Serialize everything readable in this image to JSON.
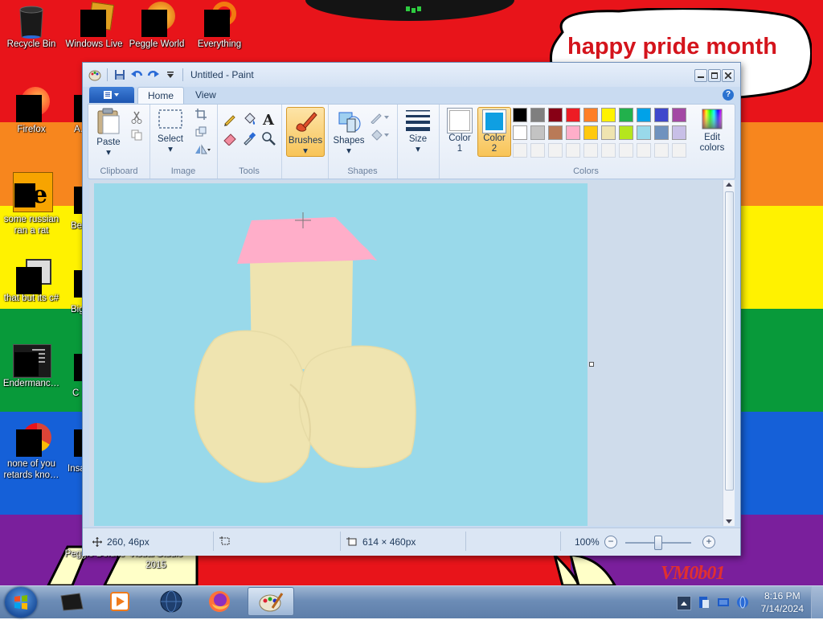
{
  "desktop": {
    "speech_text": "happy pride month",
    "watermark": "VM0b01",
    "icons": [
      {
        "label": "Recycle Bin"
      },
      {
        "label": "Windows Live"
      },
      {
        "label": "Peggle World"
      },
      {
        "label": "Everything"
      },
      {
        "label": "Firefox"
      },
      {
        "label": "A…"
      },
      {
        "label": "some russian ran a rat"
      },
      {
        "label": "Be"
      },
      {
        "label": "that but its c#"
      },
      {
        "label": "Big"
      },
      {
        "label": "Endermanc…"
      },
      {
        "label": "C"
      },
      {
        "label": "none of you retards kno…"
      },
      {
        "label": "Insa"
      },
      {
        "label": "Peggle Deluxe"
      },
      {
        "label": "Visual Studio 2015"
      }
    ]
  },
  "paint": {
    "title": "Untitled - Paint",
    "tabs": [
      "Home",
      "View"
    ],
    "groups": {
      "clipboard": "Clipboard",
      "image": "Image",
      "tools": "Tools",
      "shapes": "Shapes",
      "colors": "Colors"
    },
    "buttons": {
      "paste": "Paste",
      "select": "Select",
      "brushes": "Brushes",
      "shapes": "Shapes",
      "size": "Size",
      "color1_a": "Color",
      "color1_b": "1",
      "color2_a": "Color",
      "color2_b": "2",
      "edit_colors_a": "Edit",
      "edit_colors_b": "colors"
    },
    "color1": "#ffffff",
    "color2": "#0f9fe2",
    "palette_row1": [
      "#000000",
      "#7f7f7f",
      "#880015",
      "#ed1c24",
      "#ff7f27",
      "#fff200",
      "#22b14c",
      "#00a2e8",
      "#3f48cc",
      "#a349a4"
    ],
    "palette_row2": [
      "#ffffff",
      "#c3c3c3",
      "#b97a57",
      "#ffaec9",
      "#ffc90e",
      "#efe4b0",
      "#b5e61d",
      "#99d9ea",
      "#7092be",
      "#c8bfe7"
    ],
    "status": {
      "cursor_pos": "260, 46px",
      "image_size": "614 × 460px",
      "zoom": "100%"
    }
  },
  "taskbar": {
    "time": "8:16 PM",
    "date": "7/14/2024"
  }
}
